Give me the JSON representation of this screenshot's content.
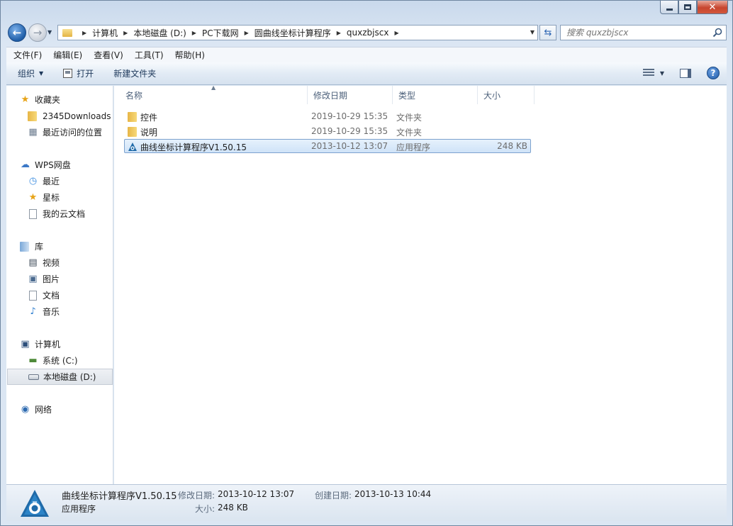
{
  "window": {
    "caption_min": "–",
    "caption_max": "□",
    "caption_close": "✕"
  },
  "address": {
    "breadcrumbs": [
      "计算机",
      "本地磁盘 (D:)",
      "PC下载网",
      "圆曲线坐标计算程序",
      "quxzbjscx"
    ],
    "search_placeholder": "搜索 quxzbjscx"
  },
  "menu": [
    "文件(F)",
    "编辑(E)",
    "查看(V)",
    "工具(T)",
    "帮助(H)"
  ],
  "toolbar": {
    "organize": "组织",
    "open": "打开",
    "new_folder": "新建文件夹"
  },
  "nav": {
    "favorites": {
      "label": "收藏夹",
      "items": [
        "2345Downloads",
        "最近访问的位置"
      ]
    },
    "wps": {
      "label": "WPS网盘",
      "items": [
        "最近",
        "星标",
        "我的云文档"
      ]
    },
    "library": {
      "label": "库",
      "items": [
        "视频",
        "图片",
        "文档",
        "音乐"
      ]
    },
    "computer": {
      "label": "计算机",
      "items": [
        "系统 (C:)",
        "本地磁盘 (D:)"
      ]
    },
    "network": {
      "label": "网络"
    }
  },
  "columns": {
    "name": "名称",
    "date": "修改日期",
    "type": "类型",
    "size": "大小"
  },
  "files": [
    {
      "name": "控件",
      "date": "2019-10-29 15:35",
      "type": "文件夹",
      "size": "",
      "icon": "folder-icon"
    },
    {
      "name": "说明",
      "date": "2019-10-29 15:35",
      "type": "文件夹",
      "size": "",
      "icon": "folder-icon"
    },
    {
      "name": "曲线坐标计算程序V1.50.15",
      "date": "2013-10-12 13:07",
      "type": "应用程序",
      "size": "248 KB",
      "icon": "app-icon"
    }
  ],
  "status": {
    "name": "曲线坐标计算程序V1.50.15",
    "type": "应用程序",
    "modified_label": "修改日期:",
    "modified_value": "2013-10-12 13:07",
    "created_label": "创建日期:",
    "created_value": "2013-10-13 10:44",
    "size_label": "大小:",
    "size_value": "248 KB"
  },
  "colors": {
    "accent": "#1f5ea8",
    "selection": "#cfe3f8",
    "folder": "#e7b646"
  }
}
